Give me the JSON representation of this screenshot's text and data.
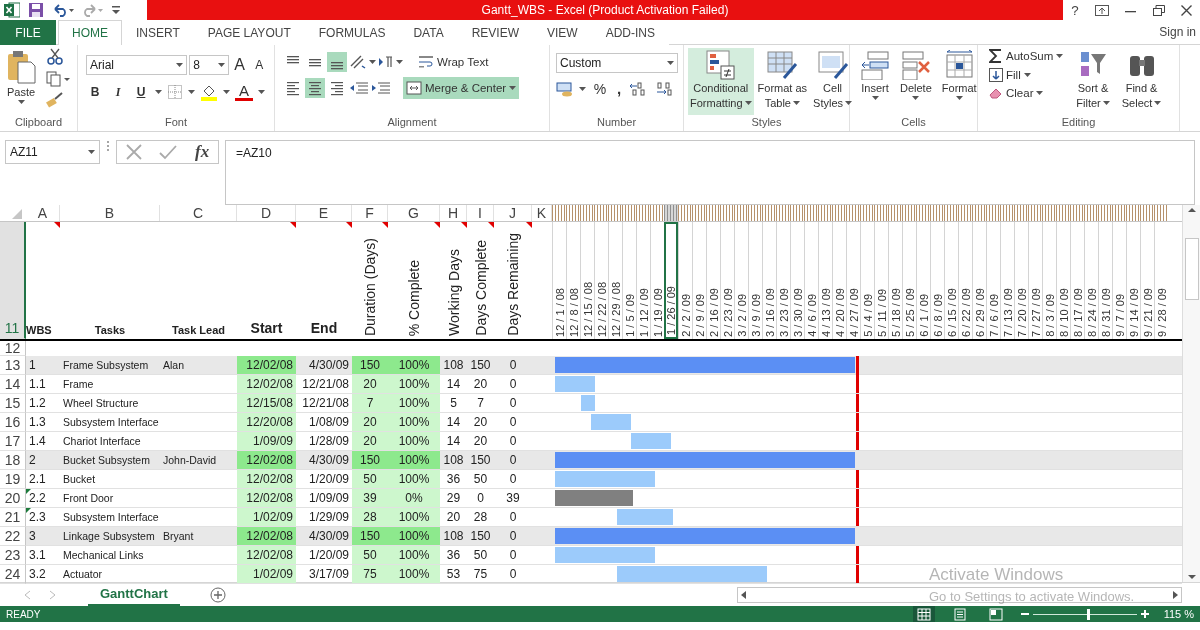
{
  "title_bar": {
    "title": "Gantt_WBS -  Excel (Product Activation Failed)",
    "help": "?"
  },
  "tabs": [
    {
      "label": "FILE",
      "kind": "file",
      "selected": false
    },
    {
      "label": "HOME",
      "kind": "tab",
      "selected": true
    },
    {
      "label": "INSERT",
      "kind": "tab",
      "selected": false
    },
    {
      "label": "PAGE LAYOUT",
      "kind": "tab",
      "selected": false
    },
    {
      "label": "FORMULAS",
      "kind": "tab",
      "selected": false
    },
    {
      "label": "DATA",
      "kind": "tab",
      "selected": false
    },
    {
      "label": "REVIEW",
      "kind": "tab",
      "selected": false
    },
    {
      "label": "VIEW",
      "kind": "tab",
      "selected": false
    },
    {
      "label": "ADD-INS",
      "kind": "tab",
      "selected": false
    }
  ],
  "sign_in": "Sign in",
  "ribbon": {
    "clipboard": {
      "label": "Clipboard",
      "paste": "Paste"
    },
    "font": {
      "label": "Font",
      "name": "Arial",
      "size": "8",
      "grow": "A",
      "shrink": "A",
      "bold": "B",
      "italic": "I",
      "underline": "U",
      "font_color_label": "A"
    },
    "alignment": {
      "label": "Alignment",
      "vertical": [
        {
          "kind": "top",
          "selected": false
        },
        {
          "kind": "middle",
          "selected": false
        },
        {
          "kind": "bottom",
          "selected": true
        }
      ],
      "horizontal": [
        {
          "kind": "left",
          "selected": false
        },
        {
          "kind": "center",
          "selected": true
        },
        {
          "kind": "right",
          "selected": false
        }
      ],
      "wrap": {
        "label": "Wrap Text",
        "selected": false
      },
      "merge": {
        "label": "Merge & Center",
        "selected": true
      }
    },
    "number": {
      "label": "Number",
      "format": "Custom",
      "percent": "%",
      "comma": ","
    },
    "styles": {
      "label": "Styles",
      "buttons": [
        {
          "lines": [
            "Conditional",
            "Formatting"
          ],
          "kind": "conditional",
          "selected": true
        },
        {
          "lines": [
            "Format as",
            "Table"
          ],
          "kind": "table",
          "selected": false
        },
        {
          "lines": [
            "Cell",
            "Styles"
          ],
          "kind": "cellstyles",
          "selected": false
        }
      ]
    },
    "cells": {
      "label": "Cells",
      "buttons": [
        {
          "label": "Insert",
          "kind": "insert"
        },
        {
          "label": "Delete",
          "kind": "delete"
        },
        {
          "label": "Format",
          "kind": "format"
        }
      ]
    },
    "editing": {
      "label": "Editing",
      "autosum": "AutoSum",
      "fill": "Fill",
      "clear": "Clear",
      "sort": [
        "Sort &",
        "Filter"
      ],
      "find": [
        "Find &",
        "Select"
      ]
    }
  },
  "formula_bar": {
    "name_box": "AZ11",
    "fx": "fx",
    "formula": "=AZ10"
  },
  "sheet": {
    "column_letters": [
      "A",
      "B",
      "C",
      "D",
      "E",
      "F",
      "G",
      "H",
      "I",
      "J",
      "K"
    ],
    "header_row": {
      "number": "11",
      "selected": true,
      "cells": [
        {
          "text": "WBS",
          "comment": true
        },
        {
          "text": "Tasks",
          "comment": false
        },
        {
          "text": "Task Lead",
          "comment": false
        },
        {
          "text": "Start",
          "comment": true
        },
        {
          "text": "End",
          "comment": true
        },
        {
          "text": "Duration (Days)",
          "comment": true
        },
        {
          "text": "% Complete",
          "comment": true
        },
        {
          "text": "Working Days",
          "comment": true
        },
        {
          "text": "Days Complete",
          "comment": true
        },
        {
          "text": "Days Remaining",
          "comment": true
        }
      ]
    },
    "dates": [
      {
        "text": "12 / 1 / 08",
        "selected": false
      },
      {
        "text": "12 / 8 / 08",
        "selected": false
      },
      {
        "text": "12 / 15 / 08",
        "selected": false
      },
      {
        "text": "12 / 22 / 08",
        "selected": false
      },
      {
        "text": "12 / 29 / 08",
        "selected": false
      },
      {
        "text": "1 / 5 / 09",
        "selected": false
      },
      {
        "text": "1 / 12 / 09",
        "selected": false
      },
      {
        "text": "1 / 19 / 09",
        "selected": false
      },
      {
        "text": "1 / 26 / 09",
        "selected": true
      },
      {
        "text": "2 / 2 / 09",
        "selected": false
      },
      {
        "text": "2 / 9 / 09",
        "selected": false
      },
      {
        "text": "2 / 16 / 09",
        "selected": false
      },
      {
        "text": "2 / 23 / 09",
        "selected": false
      },
      {
        "text": "3 / 2 / 09",
        "selected": false
      },
      {
        "text": "3 / 9 / 09",
        "selected": false
      },
      {
        "text": "3 / 16 / 09",
        "selected": false
      },
      {
        "text": "3 / 23 / 09",
        "selected": false
      },
      {
        "text": "3 / 30 / 09",
        "selected": false
      },
      {
        "text": "4 / 6 / 09",
        "selected": false
      },
      {
        "text": "4 / 13 / 09",
        "selected": false
      },
      {
        "text": "4 / 20 / 09",
        "selected": false
      },
      {
        "text": "4 / 27 / 09",
        "selected": false
      },
      {
        "text": "5 / 4 / 09",
        "selected": false
      },
      {
        "text": "5 / 11 / 09",
        "selected": false
      },
      {
        "text": "5 / 18 / 09",
        "selected": false
      },
      {
        "text": "5 / 25 / 09",
        "selected": false
      },
      {
        "text": "6 / 1 / 09",
        "selected": false
      },
      {
        "text": "6 / 8 / 09",
        "selected": false
      },
      {
        "text": "6 / 15 / 09",
        "selected": false
      },
      {
        "text": "6 / 22 / 09",
        "selected": false
      },
      {
        "text": "6 / 29 / 09",
        "selected": false
      },
      {
        "text": "7 / 6 / 09",
        "selected": false
      },
      {
        "text": "7 / 13 / 09",
        "selected": false
      },
      {
        "text": "7 / 20 / 09",
        "selected": false
      },
      {
        "text": "7 / 27 / 09",
        "selected": false
      },
      {
        "text": "8 / 3 / 09",
        "selected": false
      },
      {
        "text": "8 / 10 / 09",
        "selected": false
      },
      {
        "text": "8 / 17 / 09",
        "selected": false
      },
      {
        "text": "8 / 24 / 09",
        "selected": false
      },
      {
        "text": "8 / 31 / 09",
        "selected": false
      },
      {
        "text": "9 / 7 / 09",
        "selected": false
      },
      {
        "text": "9 / 14 / 09",
        "selected": false
      },
      {
        "text": "9 / 21 / 09",
        "selected": false
      },
      {
        "text": "9 / 28 / 09",
        "selected": false
      }
    ],
    "blank_row": "12",
    "rows": [
      {
        "number": "13",
        "kind": "summary",
        "error_mark": false,
        "wbs": "1",
        "task": "Frame Subsystem",
        "lead": "Alan",
        "start": "12/02/08",
        "end": "4/30/09",
        "duration": "150",
        "complete": "100%",
        "working": "108",
        "days_complete": "150",
        "remaining": "0",
        "level": 1
      },
      {
        "number": "14",
        "kind": "task",
        "error_mark": false,
        "wbs": "1.1",
        "task": "Frame",
        "start": "12/02/08",
        "end": "12/21/08",
        "duration": "20",
        "complete": "100%",
        "working": "14",
        "days_complete": "20",
        "remaining": "0",
        "level": 1
      },
      {
        "number": "15",
        "kind": "task",
        "error_mark": false,
        "wbs": "1.2",
        "task": "Wheel Structure",
        "start": "12/15/08",
        "end": "12/21/08",
        "duration": "7",
        "complete": "100%",
        "working": "5",
        "days_complete": "7",
        "remaining": "0",
        "level": 1
      },
      {
        "number": "16",
        "kind": "task",
        "error_mark": false,
        "wbs": "1.3",
        "task": "Subsystem Interface",
        "start": "12/20/08",
        "end": "1/08/09",
        "duration": "20",
        "complete": "100%",
        "working": "14",
        "days_complete": "20",
        "remaining": "0",
        "level": 1
      },
      {
        "number": "17",
        "kind": "task",
        "error_mark": false,
        "wbs": "1.4",
        "task": "Chariot Interface",
        "start": "1/09/09",
        "end": "1/28/09",
        "duration": "20",
        "complete": "100%",
        "working": "14",
        "days_complete": "20",
        "remaining": "0",
        "level": 1
      },
      {
        "number": "18",
        "kind": "summary",
        "error_mark": false,
        "wbs": "2",
        "task": "Bucket Subsystem",
        "lead": "John-David",
        "start": "12/02/08",
        "end": "4/30/09",
        "duration": "150",
        "complete": "100%",
        "working": "108",
        "days_complete": "150",
        "remaining": "0",
        "level": 1
      },
      {
        "number": "19",
        "kind": "task",
        "error_mark": false,
        "wbs": "2.1",
        "task": "Bucket",
        "start": "12/02/08",
        "end": "1/20/09",
        "duration": "50",
        "complete": "100%",
        "working": "36",
        "days_complete": "50",
        "remaining": "0",
        "level": 1
      },
      {
        "number": "20",
        "kind": "task",
        "error_mark": true,
        "wbs": "2.2",
        "task": "Front Door",
        "start": "12/02/08",
        "end": "1/09/09",
        "duration": "39",
        "complete": "0%",
        "working": "29",
        "days_complete": "0",
        "remaining": "39",
        "level": 0
      },
      {
        "number": "21",
        "kind": "task",
        "error_mark": true,
        "wbs": "2.3",
        "task": "Subsystem Interface",
        "start": "1/02/09",
        "end": "1/29/09",
        "duration": "28",
        "complete": "100%",
        "working": "20",
        "days_complete": "28",
        "remaining": "0",
        "level": 1
      },
      {
        "number": "22",
        "kind": "summary",
        "error_mark": false,
        "wbs": "3",
        "task": "Linkage Subsystem",
        "lead": "Bryant",
        "start": "12/02/08",
        "end": "4/30/09",
        "duration": "150",
        "complete": "100%",
        "working": "108",
        "days_complete": "150",
        "remaining": "0",
        "level": 1
      },
      {
        "number": "23",
        "kind": "task",
        "error_mark": false,
        "wbs": "3.1",
        "task": "Mechanical Links",
        "start": "12/02/08",
        "end": "1/20/09",
        "duration": "50",
        "complete": "100%",
        "working": "36",
        "days_complete": "50",
        "remaining": "0",
        "level": 1
      },
      {
        "number": "24",
        "kind": "task",
        "error_mark": false,
        "wbs": "3.2",
        "task": "Actuator",
        "start": "1/02/09",
        "end": "3/17/09",
        "duration": "75",
        "complete": "100%",
        "working": "53",
        "days_complete": "75",
        "remaining": "0",
        "level": 1
      }
    ]
  },
  "sheet_tabs": [
    {
      "label": "GanttChart",
      "selected": true
    }
  ],
  "status_bar": {
    "status": "READY",
    "views": [
      {
        "kind": "normal",
        "selected": true
      },
      {
        "kind": "layout",
        "selected": false
      },
      {
        "kind": "pagebreak",
        "selected": false
      }
    ],
    "zoom": {
      "level": 0.52,
      "label": "115 %"
    }
  },
  "activation": {
    "title": "Activate Windows",
    "message": "Go to Settings to activate Windows."
  }
}
